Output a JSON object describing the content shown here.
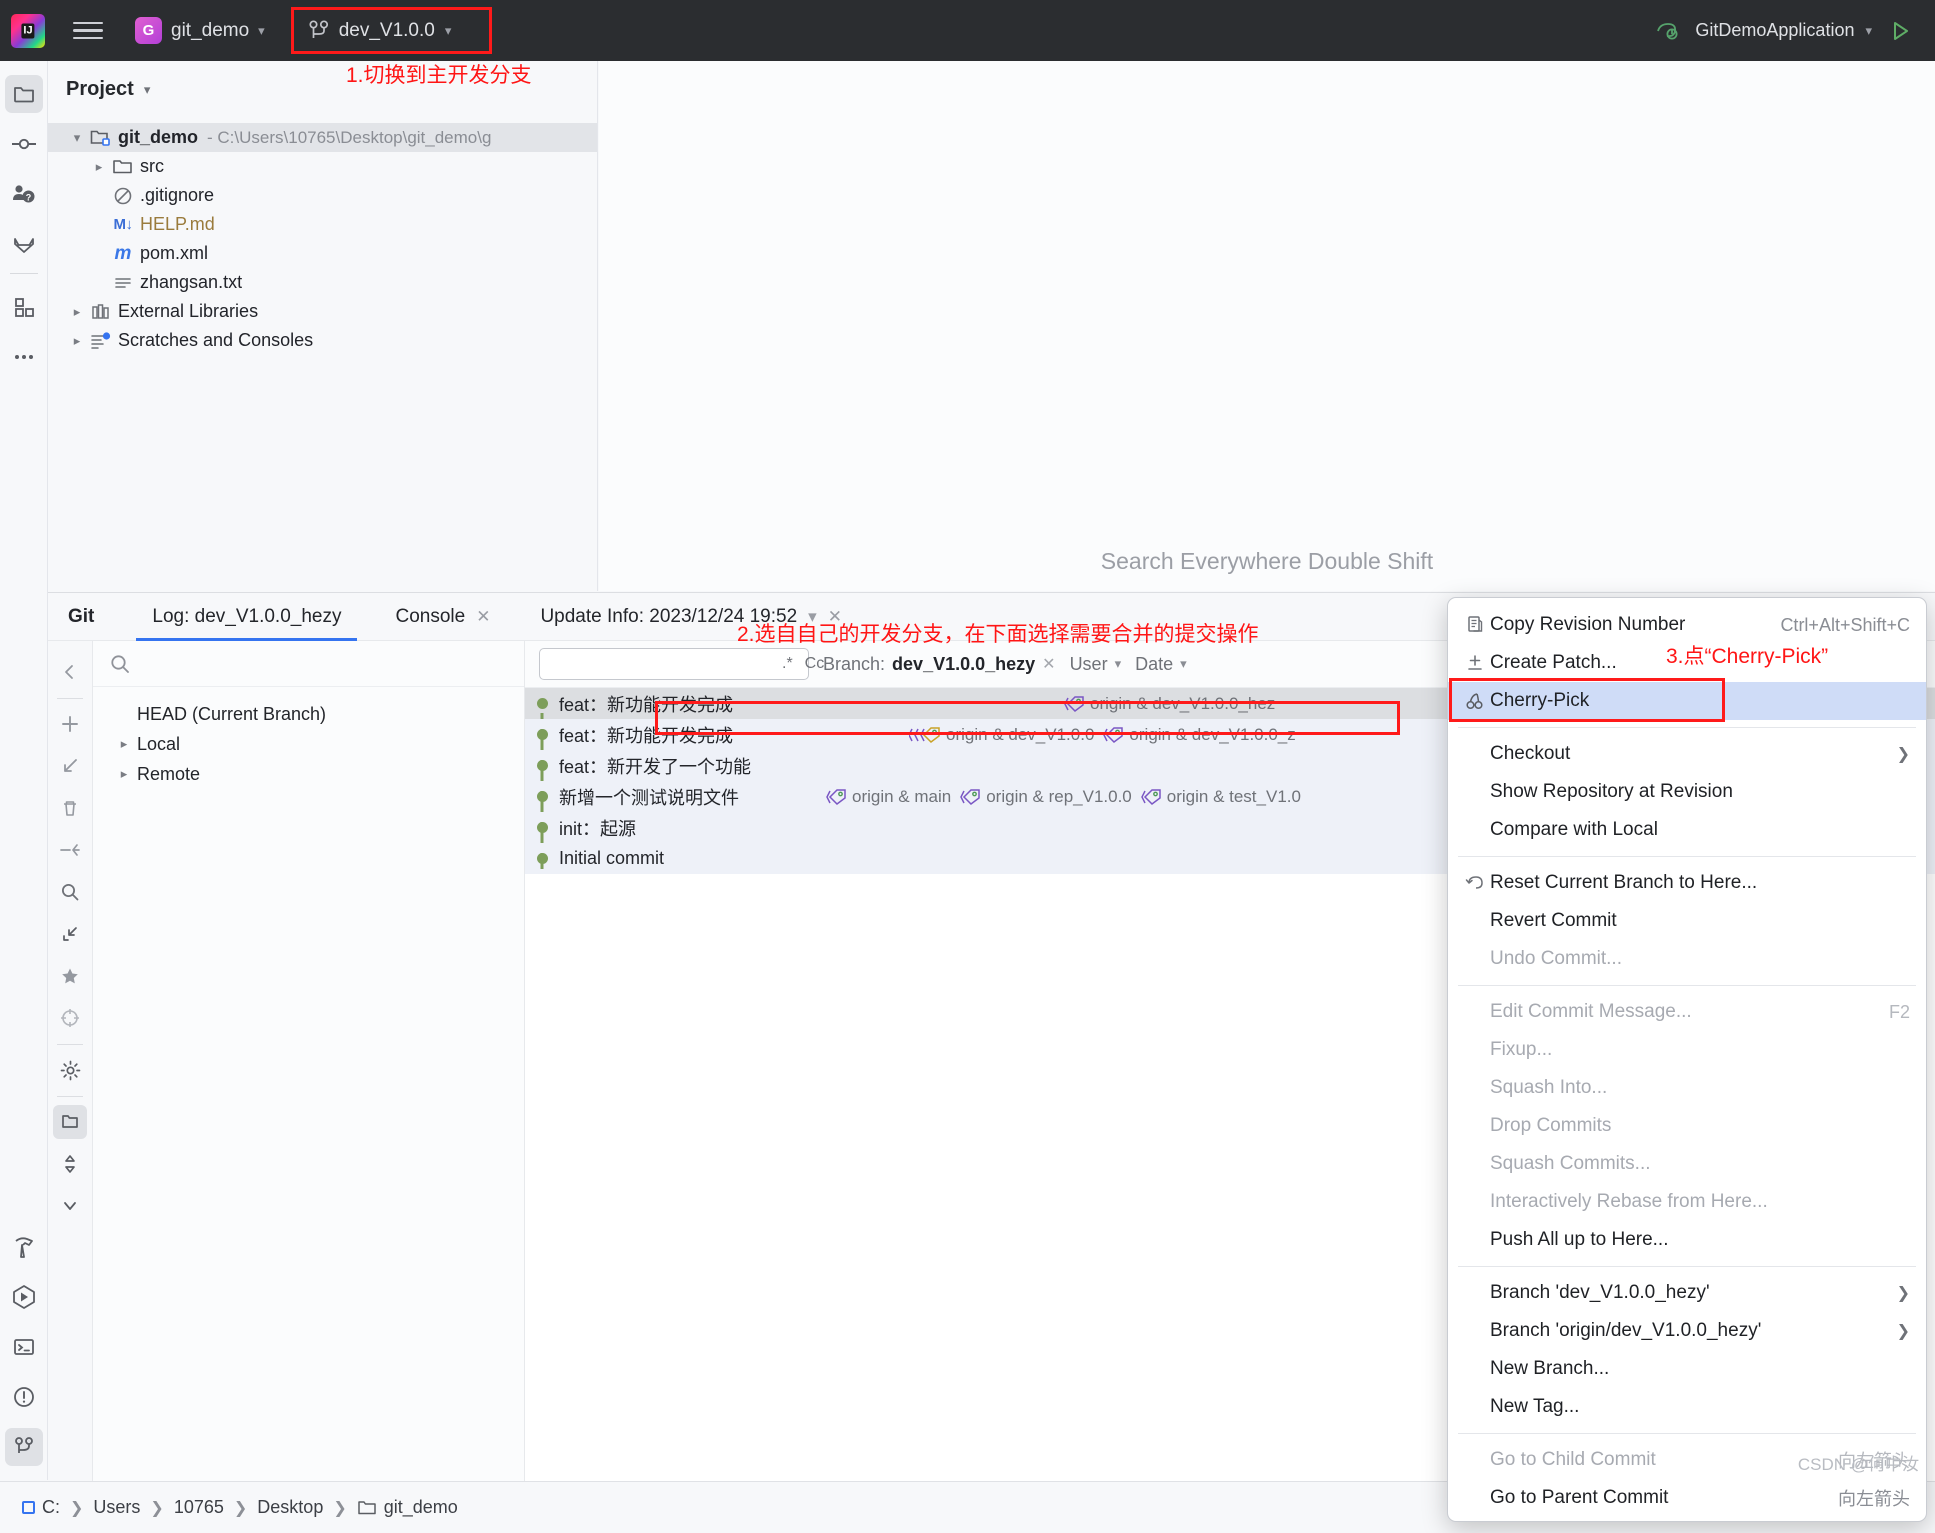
{
  "titlebar": {
    "logo_icon": "intellij-logo-icon",
    "menu_icon": "hamburger-menu-icon",
    "project_badge": "G",
    "project_name": "git_demo",
    "branch_icon": "git-branch-icon",
    "branch_name": "dev_V1.0.0",
    "run_config_icon": "spring-boot-icon",
    "run_config_name": "GitDemoApplication",
    "run_icon": "run-play-icon"
  },
  "left_strip": {
    "items": [
      {
        "name": "project-tool-icon",
        "glyph": "folder",
        "selected": true
      },
      {
        "name": "commit-tool-icon",
        "glyph": "commit",
        "selected": false
      },
      {
        "name": "pull-requests-tool-icon",
        "glyph": "pullrequest",
        "selected": false
      },
      {
        "name": "gitlab-tool-icon",
        "glyph": "gitlab",
        "selected": false
      },
      {
        "name": "plugins-tool-icon",
        "glyph": "squares",
        "selected": false
      },
      {
        "name": "more-tool-windows-icon",
        "glyph": "dots",
        "selected": false
      }
    ],
    "bottom_items": [
      {
        "name": "build-tool-icon",
        "glyph": "hammer",
        "selected": false
      },
      {
        "name": "run-tool-icon",
        "glyph": "runhex",
        "selected": false
      },
      {
        "name": "terminal-tool-icon",
        "glyph": "terminal",
        "selected": false
      },
      {
        "name": "problems-tool-icon",
        "glyph": "warning",
        "selected": false
      },
      {
        "name": "git-tool-icon",
        "glyph": "branch",
        "selected": true
      }
    ]
  },
  "project_panel": {
    "title": "Project",
    "chevron": "chevron-down-icon",
    "tree": [
      {
        "indent": 0,
        "arrow": "down",
        "icon": "module-folder-icon",
        "label": "git_demo",
        "bold": true,
        "path": "- C:\\Users\\10765\\Desktop\\git_demo\\g",
        "selected": true
      },
      {
        "indent": 1,
        "arrow": "right",
        "icon": "folder-icon",
        "label": "src",
        "bold": false,
        "path": "",
        "selected": false
      },
      {
        "indent": 1,
        "arrow": "none",
        "icon": "gitignore-icon",
        "label": ".gitignore",
        "bold": false,
        "path": "",
        "selected": false
      },
      {
        "indent": 1,
        "arrow": "none",
        "icon": "markdown-icon",
        "label": "HELP.md",
        "bold": false,
        "path": "",
        "selected": false
      },
      {
        "indent": 1,
        "arrow": "none",
        "icon": "maven-icon",
        "label": "pom.xml",
        "bold": false,
        "path": "",
        "selected": false
      },
      {
        "indent": 1,
        "arrow": "none",
        "icon": "text-file-icon",
        "label": "zhangsan.txt",
        "bold": false,
        "path": "",
        "selected": false
      },
      {
        "indent": 0,
        "arrow": "right",
        "icon": "library-icon",
        "label": "External Libraries",
        "bold": false,
        "path": "",
        "selected": false
      },
      {
        "indent": 0,
        "arrow": "right",
        "icon": "scratches-icon",
        "label": "Scratches and Consoles",
        "bold": false,
        "path": "",
        "selected": false
      }
    ]
  },
  "editor": {
    "hint": "Search Everywhere Double Shift"
  },
  "git_window": {
    "tabs": [
      {
        "label": "Git",
        "bold": true,
        "closable": false,
        "active": false
      },
      {
        "label": "Log: dev_V1.0.0_hezy",
        "bold": false,
        "closable": false,
        "active": true
      },
      {
        "label": "Console",
        "bold": false,
        "closable": true,
        "active": false
      },
      {
        "label": "Update Info: 2023/12/24 19:52",
        "bold": false,
        "closable": true,
        "active": false
      }
    ],
    "toolbar_icons": [
      {
        "name": "collapse-panel-icon",
        "glyph": "chev-left"
      },
      {
        "name": "add-icon",
        "glyph": "plus"
      },
      {
        "name": "pull-icon",
        "glyph": "arrow-down-left"
      },
      {
        "name": "delete-icon",
        "glyph": "trash"
      },
      {
        "name": "merge-icon",
        "glyph": "arrow-into"
      },
      {
        "name": "search-icon",
        "glyph": "search"
      },
      {
        "name": "collapse-all-icon",
        "glyph": "collapse"
      },
      {
        "name": "favorite-icon",
        "glyph": "star"
      },
      {
        "name": "target-icon",
        "glyph": "target"
      },
      {
        "name": "settings-icon",
        "glyph": "gear"
      },
      {
        "name": "show-directories-icon",
        "glyph": "folder-sel"
      },
      {
        "name": "expand-collapse-icon",
        "glyph": "updown"
      },
      {
        "name": "hide-icon",
        "glyph": "chev-down"
      }
    ],
    "branch_pane": {
      "search_icon": "search-icon",
      "search_placeholder": "",
      "rows": [
        {
          "label": "HEAD (Current Branch)",
          "arrow": "none"
        },
        {
          "label": "Local",
          "arrow": "right"
        },
        {
          "label": "Remote",
          "arrow": "right"
        }
      ]
    },
    "filter_bar": {
      "search_icon": "search-dropdown-icon",
      "search_value": "",
      "regex_label": ".*",
      "case_label": "Cc",
      "branch_label": "Branch:",
      "branch_value": "dev_V1.0.0_hezy",
      "branch_clear_icon": "close-icon",
      "user_label": "User",
      "date_label": "Date"
    },
    "commits": [
      {
        "message": "feat：新功能开发完成",
        "selected": true,
        "refs": [
          {
            "icon": "tag-icon",
            "label": "origin & dev_V1.0.0_hez"
          }
        ]
      },
      {
        "message": "feat：新功能开发完成",
        "selected": false,
        "refs": [
          {
            "icon": "tag-double-icon",
            "label": "origin & dev_V1.0.0"
          },
          {
            "icon": "tag-icon",
            "label": "origin & dev_V1.0.0_z"
          }
        ]
      },
      {
        "message": "feat：新开发了一个功能",
        "selected": false,
        "refs": []
      },
      {
        "message": "新增一个测试说明文件",
        "selected": false,
        "refs": [
          {
            "icon": "tag-icon",
            "label": "origin & main"
          },
          {
            "icon": "tag-icon",
            "label": "origin & rep_V1.0.0"
          },
          {
            "icon": "tag-icon",
            "label": "origin & test_V1.0"
          }
        ]
      },
      {
        "message": "init：起源",
        "selected": false,
        "refs": []
      },
      {
        "message": "Initial commit",
        "selected": false,
        "refs": []
      }
    ]
  },
  "context_menu": {
    "items": [
      {
        "label": "Copy Revision Number",
        "icon": "copy-icon",
        "accel": "Ctrl+Alt+Shift+C",
        "state": "normal",
        "submenu": false
      },
      {
        "label": "Create Patch...",
        "icon": "create-patch-icon",
        "accel": "",
        "state": "normal",
        "submenu": false
      },
      {
        "label": "Cherry-Pick",
        "icon": "cherry-pick-icon",
        "accel": "",
        "state": "highlighted",
        "submenu": false
      },
      {
        "separator": true
      },
      {
        "label": "Checkout",
        "icon": "",
        "accel": "",
        "state": "normal",
        "submenu": true
      },
      {
        "label": "Show Repository at Revision",
        "icon": "",
        "accel": "",
        "state": "normal",
        "submenu": false
      },
      {
        "label": "Compare with Local",
        "icon": "",
        "accel": "",
        "state": "normal",
        "submenu": false
      },
      {
        "separator": true
      },
      {
        "label": "Reset Current Branch to Here...",
        "icon": "reset-icon",
        "accel": "",
        "state": "normal",
        "submenu": false
      },
      {
        "label": "Revert Commit",
        "icon": "",
        "accel": "",
        "state": "normal",
        "submenu": false
      },
      {
        "label": "Undo Commit...",
        "icon": "",
        "accel": "",
        "state": "disabled",
        "submenu": false
      },
      {
        "separator": true
      },
      {
        "label": "Edit Commit Message...",
        "icon": "",
        "accel": "F2",
        "state": "disabled",
        "submenu": false
      },
      {
        "label": "Fixup...",
        "icon": "",
        "accel": "",
        "state": "disabled",
        "submenu": false
      },
      {
        "label": "Squash Into...",
        "icon": "",
        "accel": "",
        "state": "disabled",
        "submenu": false
      },
      {
        "label": "Drop Commits",
        "icon": "",
        "accel": "",
        "state": "disabled",
        "submenu": false
      },
      {
        "label": "Squash Commits...",
        "icon": "",
        "accel": "",
        "state": "disabled",
        "submenu": false
      },
      {
        "label": "Interactively Rebase from Here...",
        "icon": "",
        "accel": "",
        "state": "disabled",
        "submenu": false
      },
      {
        "label": "Push All up to Here...",
        "icon": "",
        "accel": "",
        "state": "normal",
        "submenu": false
      },
      {
        "separator": true
      },
      {
        "label": "Branch 'dev_V1.0.0_hezy'",
        "icon": "",
        "accel": "",
        "state": "normal",
        "submenu": true
      },
      {
        "label": "Branch 'origin/dev_V1.0.0_hezy'",
        "icon": "",
        "accel": "",
        "state": "normal",
        "submenu": true
      },
      {
        "label": "New Branch...",
        "icon": "",
        "accel": "",
        "state": "normal",
        "submenu": false
      },
      {
        "label": "New Tag...",
        "icon": "",
        "accel": "",
        "state": "normal",
        "submenu": false
      },
      {
        "separator": true
      },
      {
        "label": "Go to Child Commit",
        "icon": "",
        "accel": "向左箭头",
        "state": "disabled",
        "submenu": false
      },
      {
        "label": "Go to Parent Commit",
        "icon": "",
        "accel": "向左箭头",
        "state": "normal",
        "submenu": false
      }
    ]
  },
  "status_bar": {
    "breadcrumb": [
      "C:",
      "Users",
      "10765",
      "Desktop",
      "git_demo"
    ],
    "folder_icon": "folder-icon"
  },
  "annotations": [
    {
      "id": "step1",
      "text": "1.切换到主开发分支"
    },
    {
      "id": "step2",
      "text": "2.选自自己的开发分支，在下面选择需要合并的提交操作"
    },
    {
      "id": "step3",
      "text": "3.点“Cherry-Pick”"
    }
  ],
  "watermark": "CSDN @何中汝",
  "colors": {
    "accent": "#3574f0",
    "annotation_red": "#ff1515",
    "titlebar_bg": "#2b2d30",
    "graph_node": "#7d9e5a",
    "highlight_menu": "#cfdcf7"
  }
}
